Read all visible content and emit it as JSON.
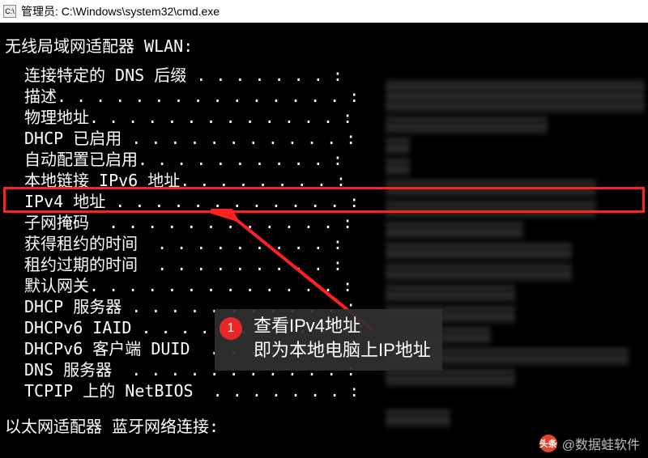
{
  "titlebar": {
    "icon_label": "C:\\",
    "title": "管理员: C:\\Windows\\system32\\cmd.exe"
  },
  "terminal": {
    "adapter_header": "无线局域网适配器 WLAN:",
    "lines": [
      "连接特定的 DNS 后缀 . . . . . . . :",
      "描述. . . . . . . . . . . . . . . :",
      "物理地址. . . . . . . . . . . . . :",
      "DHCP 已启用 . . . . . . . . . . . :",
      "自动配置已启用. . . . . . . . . . :",
      "本地链接 IPv6 地址. . . . . . . . :",
      "IPv4 地址 . . . . . . . . . . . . :",
      "子网掩码  . . . . . . . . . . . . :",
      "获得租约的时间  . . . . . . . . . :",
      "租约过期的时间  . . . . . . . . . :",
      "默认网关. . . . . . . . . . . . . :",
      "DHCP 服务器 . . . . . . . . . . . :",
      "DHCPv6 IAID . . . . . . . . . . . :",
      "DHCPv6 客户端 DUID  . . . . . . . :",
      "DNS 服务器  . . . . . . . . . . . :",
      "",
      "TCPIP 上的 NetBIOS  . . . . . . . :"
    ],
    "footer_header": "以太网适配器 蓝牙网络连接:"
  },
  "annotation": {
    "badge": "1",
    "line1": "查看IPv4地址",
    "line2": "即为本地电脑上IP地址"
  },
  "watermark": {
    "logo": "头条",
    "text": "@数据蛙软件"
  }
}
